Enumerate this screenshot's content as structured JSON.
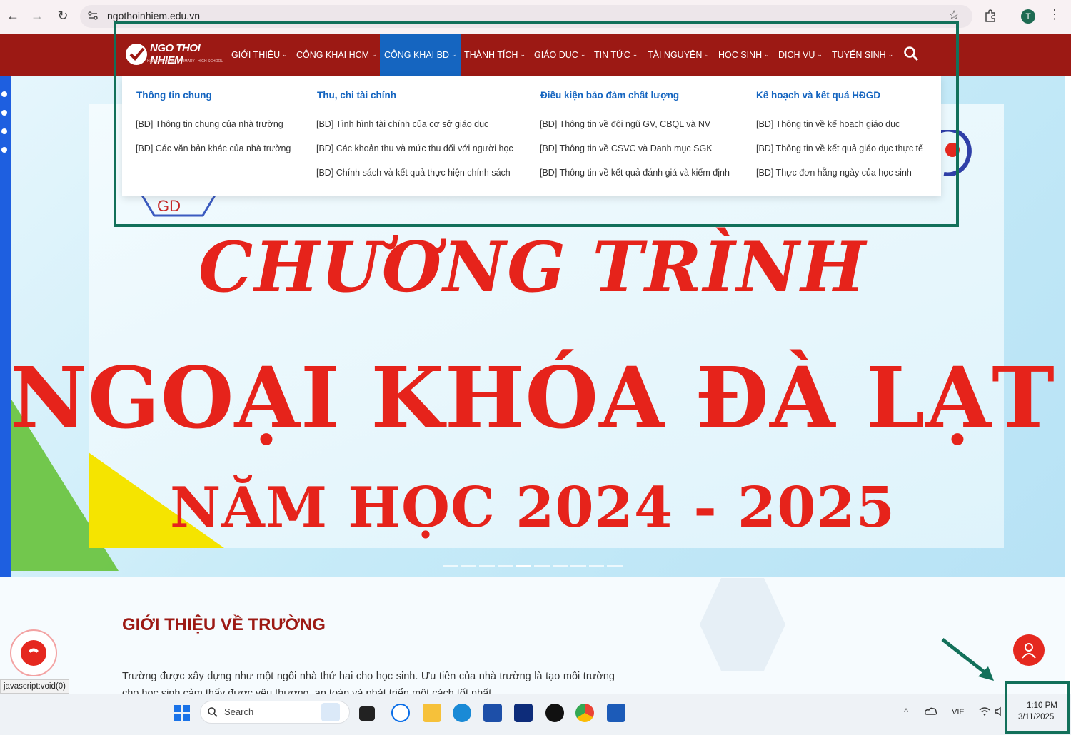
{
  "browser": {
    "url": "ngothoinhiem.edu.vn",
    "profile_initial": "T"
  },
  "site": {
    "logo_text": "NGO THOI NHIEM",
    "logo_sub": "KINDERGARTEN - PRIMARY - HIGH SCHOOL",
    "nav": [
      {
        "label": "GIỚI THIỆU"
      },
      {
        "label": "CÔNG KHAI HCM"
      },
      {
        "label": "CÔNG KHAI BD",
        "active": true
      },
      {
        "label": "THÀNH TÍCH"
      },
      {
        "label": "GIÁO DỤC"
      },
      {
        "label": "TIN TỨC"
      },
      {
        "label": "TÀI NGUYÊN"
      },
      {
        "label": "HỌC SINH"
      },
      {
        "label": "DỊCH VỤ"
      },
      {
        "label": "TUYỂN SINH"
      }
    ]
  },
  "mega_menu": {
    "columns": [
      {
        "heading": "Thông tin chung",
        "links": [
          "[BD] Thông tin chung của nhà trường",
          "[BD] Các văn bản khác của nhà trường"
        ]
      },
      {
        "heading": "Thu, chi tài chính",
        "links": [
          "[BD] Tình hình tài chính của cơ sở giáo dục",
          "[BD] Các khoản thu và mức thu đối với người học",
          "[BD] Chính sách và kết quả thực hiện chính sách"
        ]
      },
      {
        "heading": "Điều kiện bảo đảm chất lượng",
        "links": [
          "[BD] Thông tin về đội ngũ GV, CBQL và NV",
          "[BD] Thông tin về CSVC và Danh mục SGK",
          "[BD] Thông tin về kết quả đánh giá và kiểm định"
        ]
      },
      {
        "heading": "Kế hoạch và kết quả HĐGD",
        "links": [
          "[BD] Thông tin về kế hoạch giáo dục",
          "[BD] Thông tin về kết quả giáo dục thực tế",
          "[BD] Thực đơn hằng ngày của học sinh"
        ]
      }
    ]
  },
  "hero": {
    "line1": "CHƯƠNG TRÌNH",
    "line2": "NGOẠI KHÓA ĐÀ LẠT",
    "line3": "NĂM HỌC 2024 - 2025",
    "badge_left": "GD"
  },
  "intro": {
    "title": "GIỚI THIỆU VỀ TRƯỜNG",
    "text": "Trường được xây dựng như một ngôi nhà thứ hai cho học sinh. Ưu tiên của nhà trường là tạo môi trường cho học sinh cảm thấy được yêu thương, an toàn và phát triển một cách tốt nhất."
  },
  "status_bar": "javascript:void(0)",
  "taskbar": {
    "search_label": "Search",
    "lang": "VIE",
    "time": "1:10 PM",
    "date": "3/11/2025"
  },
  "colors": {
    "nav_bg": "#9c1914",
    "active_nav": "#1565c0",
    "hero_text": "#e6231b",
    "highlight": "#12705a"
  }
}
